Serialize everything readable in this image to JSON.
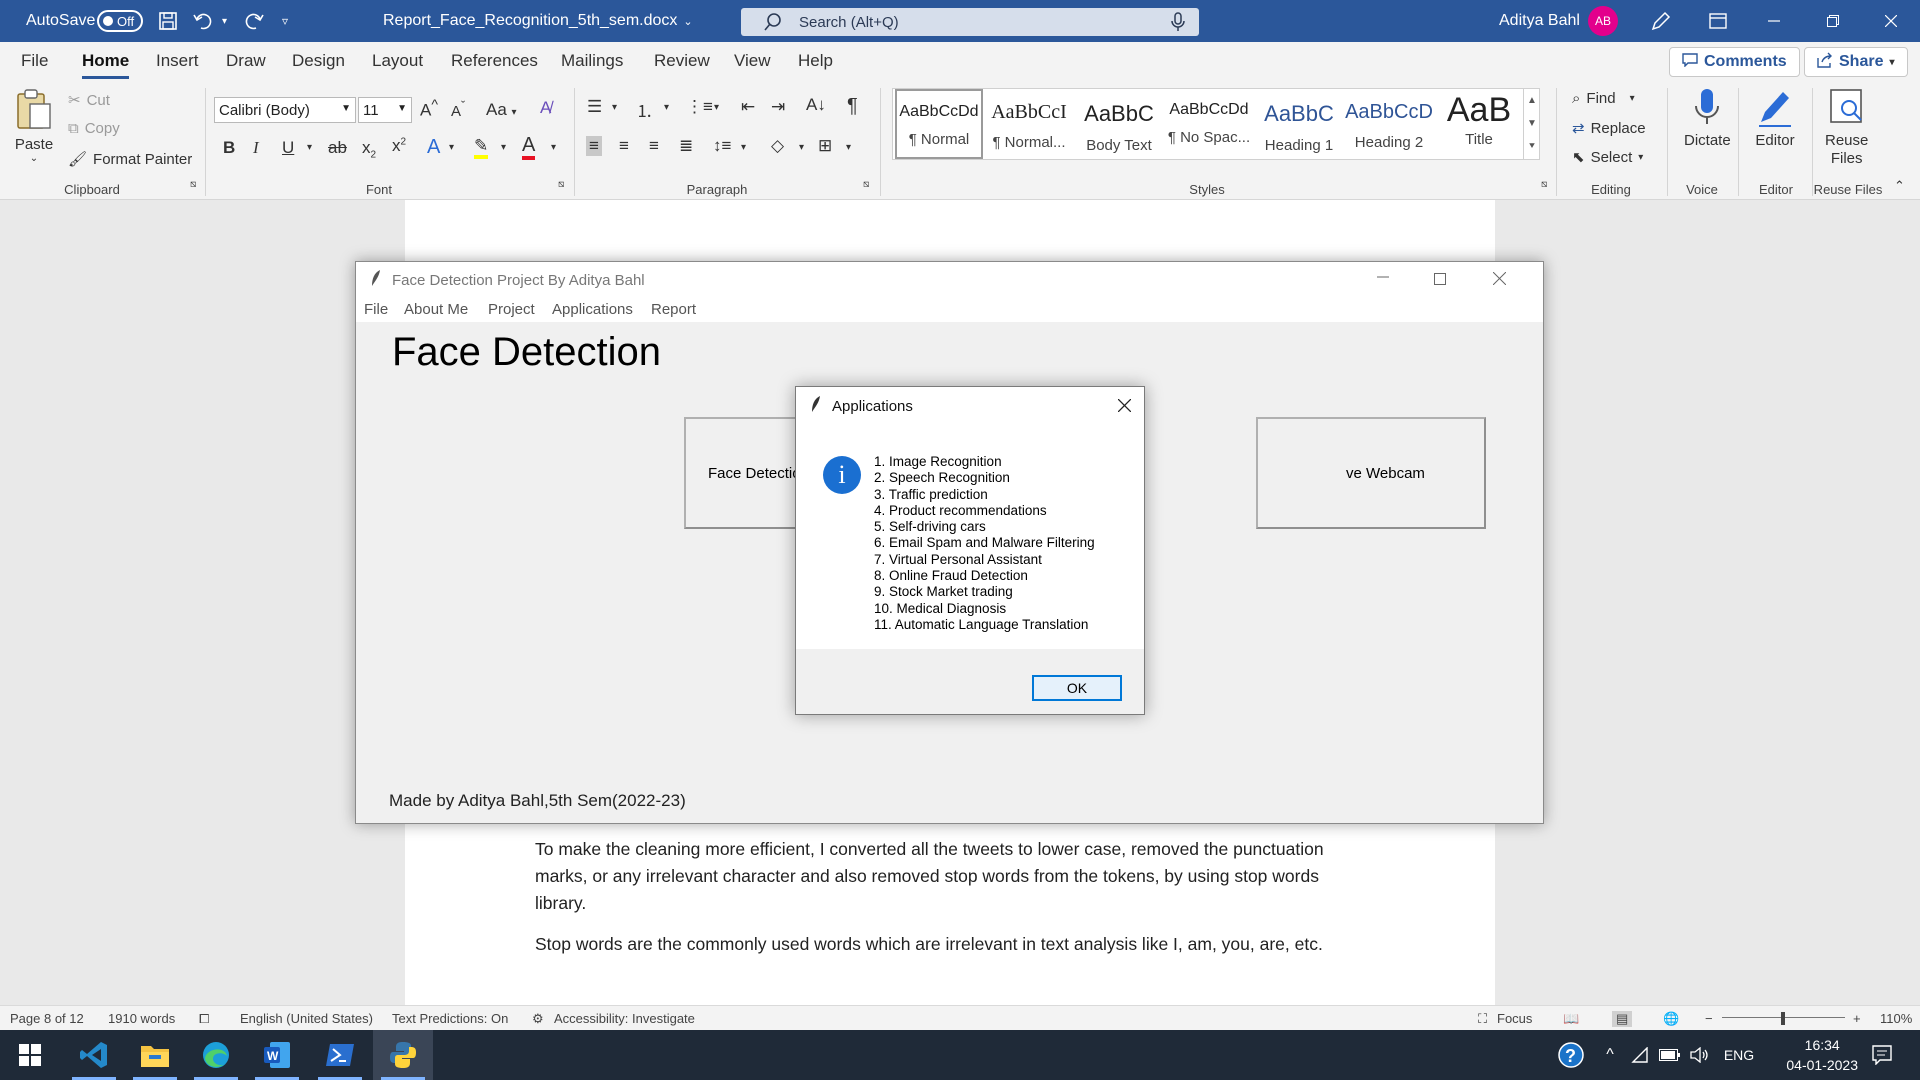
{
  "titlebar": {
    "autosave_label": "AutoSave",
    "autosave_state": "Off",
    "doc_name": "Report_Face_Recognition_5th_sem.docx",
    "search_placeholder": "Search (Alt+Q)",
    "user_name": "Aditya Bahl",
    "user_initials": "AB",
    "accent": "#2b579a"
  },
  "ribbon_tabs": [
    "File",
    "Home",
    "Insert",
    "Draw",
    "Design",
    "Layout",
    "References",
    "Mailings",
    "Review",
    "View",
    "Help"
  ],
  "active_tab": "Home",
  "comments_label": "Comments",
  "share_label": "Share",
  "clipboard": {
    "paste": "Paste",
    "cut": "Cut",
    "copy": "Copy",
    "format_painter": "Format Painter",
    "label": "Clipboard"
  },
  "font": {
    "name": "Calibri (Body)",
    "size": "11",
    "case": "Aa",
    "label": "Font"
  },
  "paragraph": {
    "label": "Paragraph"
  },
  "styles": {
    "label": "Styles",
    "items": [
      {
        "preview": "AaBbCcDd",
        "name": "¶ Normal"
      },
      {
        "preview": "AaBbCcI",
        "name": "¶ Normal..."
      },
      {
        "preview": "AaBbC",
        "name": "Body Text"
      },
      {
        "preview": "AaBbCcDd",
        "name": "¶ No Spac..."
      },
      {
        "preview": "AaBbC",
        "name": "Heading 1"
      },
      {
        "preview": "AaBbCcD",
        "name": "Heading 2"
      },
      {
        "preview": "AaB",
        "name": "Title"
      }
    ]
  },
  "editing": {
    "find": "Find",
    "replace": "Replace",
    "select": "Select",
    "label": "Editing"
  },
  "voice": {
    "dictate": "Dictate",
    "label": "Voice"
  },
  "editor": {
    "editor": "Editor",
    "label": "Editor"
  },
  "reuse": {
    "line1": "Reuse",
    "line2": "Files",
    "label": "Reuse Files"
  },
  "document": {
    "para1": "To make the cleaning more efficient, I converted all the tweets to lower case, removed the punctuation marks, or any irrelevant character and also removed stop words from the tokens, by using stop words library.",
    "para2": "Stop words are the commonly used words which are irrelevant in text analysis like I, am, you, are, etc."
  },
  "app": {
    "title": "Face Detection Project By Aditya Bahl",
    "menu": [
      "File",
      "About Me",
      "Project",
      "Applications",
      "Report"
    ],
    "heading": "Face Detection",
    "button_left": "Face Detectio",
    "button_right": "ve Webcam",
    "footer": "Made by Aditya Bahl,5th Sem(2022-23)"
  },
  "dialog": {
    "title": "Applications",
    "items": [
      "1. Image Recognition",
      "2. Speech Recognition",
      "3. Traffic prediction",
      "4. Product recommendations",
      "5. Self-driving cars",
      "6. Email Spam and Malware Filtering",
      "7. Virtual Personal Assistant",
      "8. Online Fraud Detection",
      "9. Stock Market trading",
      "10. Medical Diagnosis",
      "11. Automatic Language Translation"
    ],
    "ok": "OK"
  },
  "statusbar": {
    "page": "Page 8 of 12",
    "words": "1910 words",
    "language": "English (United States)",
    "predictions": "Text Predictions: On",
    "accessibility": "Accessibility: Investigate",
    "focus": "Focus",
    "zoom": "110%"
  },
  "taskbar": {
    "lang": "ENG",
    "time": "16:34",
    "date": "04-01-2023"
  }
}
